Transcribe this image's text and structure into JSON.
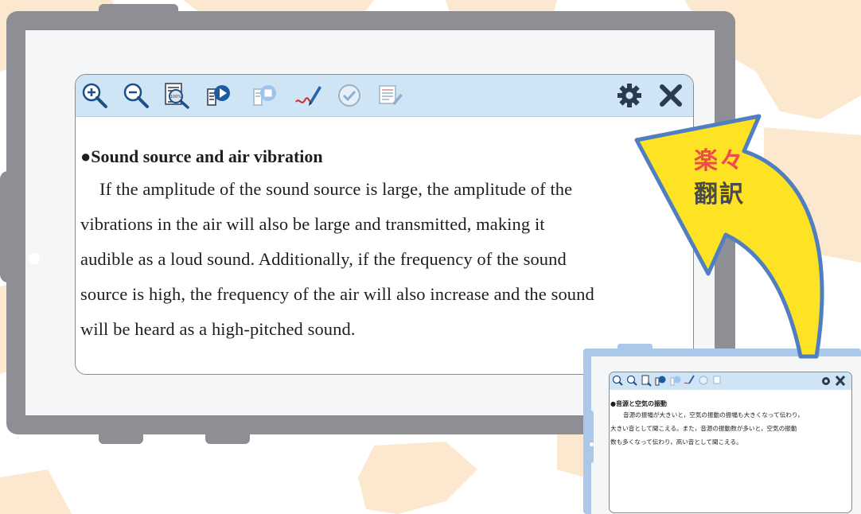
{
  "colors": {
    "map_bg": "#fbe8cf",
    "tablet_frame": "#8d8f94",
    "toolbar_bg": "#cfe5f6",
    "arrow_fill": "#fde324",
    "arrow_outline": "#4f7fc0",
    "badge_text_top": "#ee4d4d",
    "badge_text_bottom": "#4a4a4a",
    "mini_tablet": "#a9c8ea"
  },
  "toolbar": {
    "buttons": [
      {
        "name": "zoom-in",
        "icon": "zoom-in-icon"
      },
      {
        "name": "zoom-out",
        "icon": "zoom-out-icon"
      },
      {
        "name": "zoom-100",
        "icon": "zoom-100-icon",
        "label": "100%"
      },
      {
        "name": "read-aloud",
        "icon": "play-icon"
      },
      {
        "name": "stop",
        "icon": "stop-icon"
      },
      {
        "name": "pen",
        "icon": "pen-icon"
      },
      {
        "name": "check",
        "icon": "check-icon"
      },
      {
        "name": "edit-notes",
        "icon": "edit-notes-icon"
      }
    ],
    "right": [
      {
        "name": "settings",
        "icon": "gear-icon"
      },
      {
        "name": "close",
        "icon": "close-icon"
      }
    ]
  },
  "main": {
    "heading": "●Sound source and air vibration",
    "paragraph_lines": [
      "If the amplitude of the sound source is large, the amplitude of the",
      "vibrations in the air will also be large and transmitted, making it",
      "audible as a loud sound. Additionally, if the frequency of the sound",
      "source is high, the frequency of the air will also increase and the sound",
      "will be heard as a high-pitched sound."
    ]
  },
  "badge": {
    "line1": "楽々",
    "line2": "翻訳"
  },
  "mini": {
    "heading": "●音源と空気の振動",
    "paragraph_lines": [
      "音源の振幅が大きいと，空気の振動の振幅も大きくなって伝わり，",
      "大きい音として聞こえる。また，音源の振動数が多いと，空気の振動",
      "数も多くなって伝わり，高い音として聞こえる。"
    ]
  }
}
